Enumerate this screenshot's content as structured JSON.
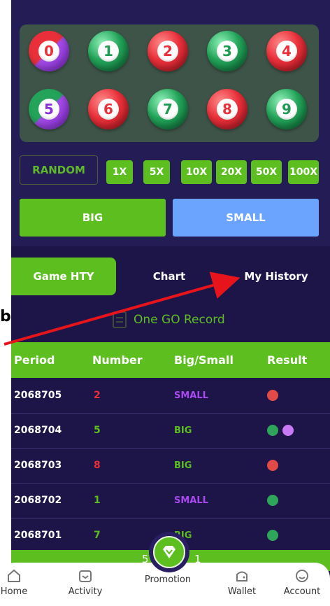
{
  "balls": [
    {
      "n": "0",
      "style": "purple-red",
      "tc": "red-t"
    },
    {
      "n": "1",
      "style": "green",
      "tc": "green-t"
    },
    {
      "n": "2",
      "style": "red",
      "tc": "red-t"
    },
    {
      "n": "3",
      "style": "green",
      "tc": "green-t"
    },
    {
      "n": "4",
      "style": "red",
      "tc": "red-t"
    },
    {
      "n": "5",
      "style": "purple-green",
      "tc": "purple-t"
    },
    {
      "n": "6",
      "style": "red",
      "tc": "red-t"
    },
    {
      "n": "7",
      "style": "green",
      "tc": "green-t"
    },
    {
      "n": "8",
      "style": "red",
      "tc": "red-t"
    },
    {
      "n": "9",
      "style": "green",
      "tc": "green-t"
    }
  ],
  "controls": {
    "random_label": "RANDOM",
    "multipliers": [
      "1X",
      "5X",
      "10X",
      "20X",
      "50X",
      "100X"
    ],
    "big_label": "BIG",
    "small_label": "SMALL"
  },
  "tabs": {
    "game": "Game HTY",
    "chart": "Chart",
    "history": "My History"
  },
  "record_title": "One GO Record",
  "table": {
    "headers": {
      "period": "Period",
      "number": "Number",
      "bigsmall": "Big/Small",
      "result": "Result"
    },
    "rows": [
      {
        "period": "2068705",
        "number": "2",
        "num_color": "#e9303a",
        "bs": "SMALL",
        "dots": [
          "red"
        ]
      },
      {
        "period": "2068704",
        "number": "5",
        "num_color": "#5cbf1f",
        "bs": "BIG",
        "dots": [
          "green",
          "purple"
        ]
      },
      {
        "period": "2068703",
        "number": "8",
        "num_color": "#e9303a",
        "bs": "BIG",
        "dots": [
          "red"
        ]
      },
      {
        "period": "2068702",
        "number": "1",
        "num_color": "#5cbf1f",
        "bs": "SMALL",
        "dots": [
          "green"
        ]
      },
      {
        "period": "2068701",
        "number": "7",
        "num_color": "#5cbf1f",
        "bs": "BIG",
        "dots": [
          "green"
        ]
      }
    ]
  },
  "pager": {
    "left": "5",
    "right": "1"
  },
  "nav": {
    "home": "Home",
    "activity": "Activity",
    "promotion": "Promotion",
    "wallet": "Wallet",
    "account": "Account"
  },
  "overlay_text": "b",
  "colors": {
    "accent": "#5cbf1f",
    "small": "#6aa4ff",
    "bg": "#1d1448",
    "annotation": "#e8141c"
  }
}
